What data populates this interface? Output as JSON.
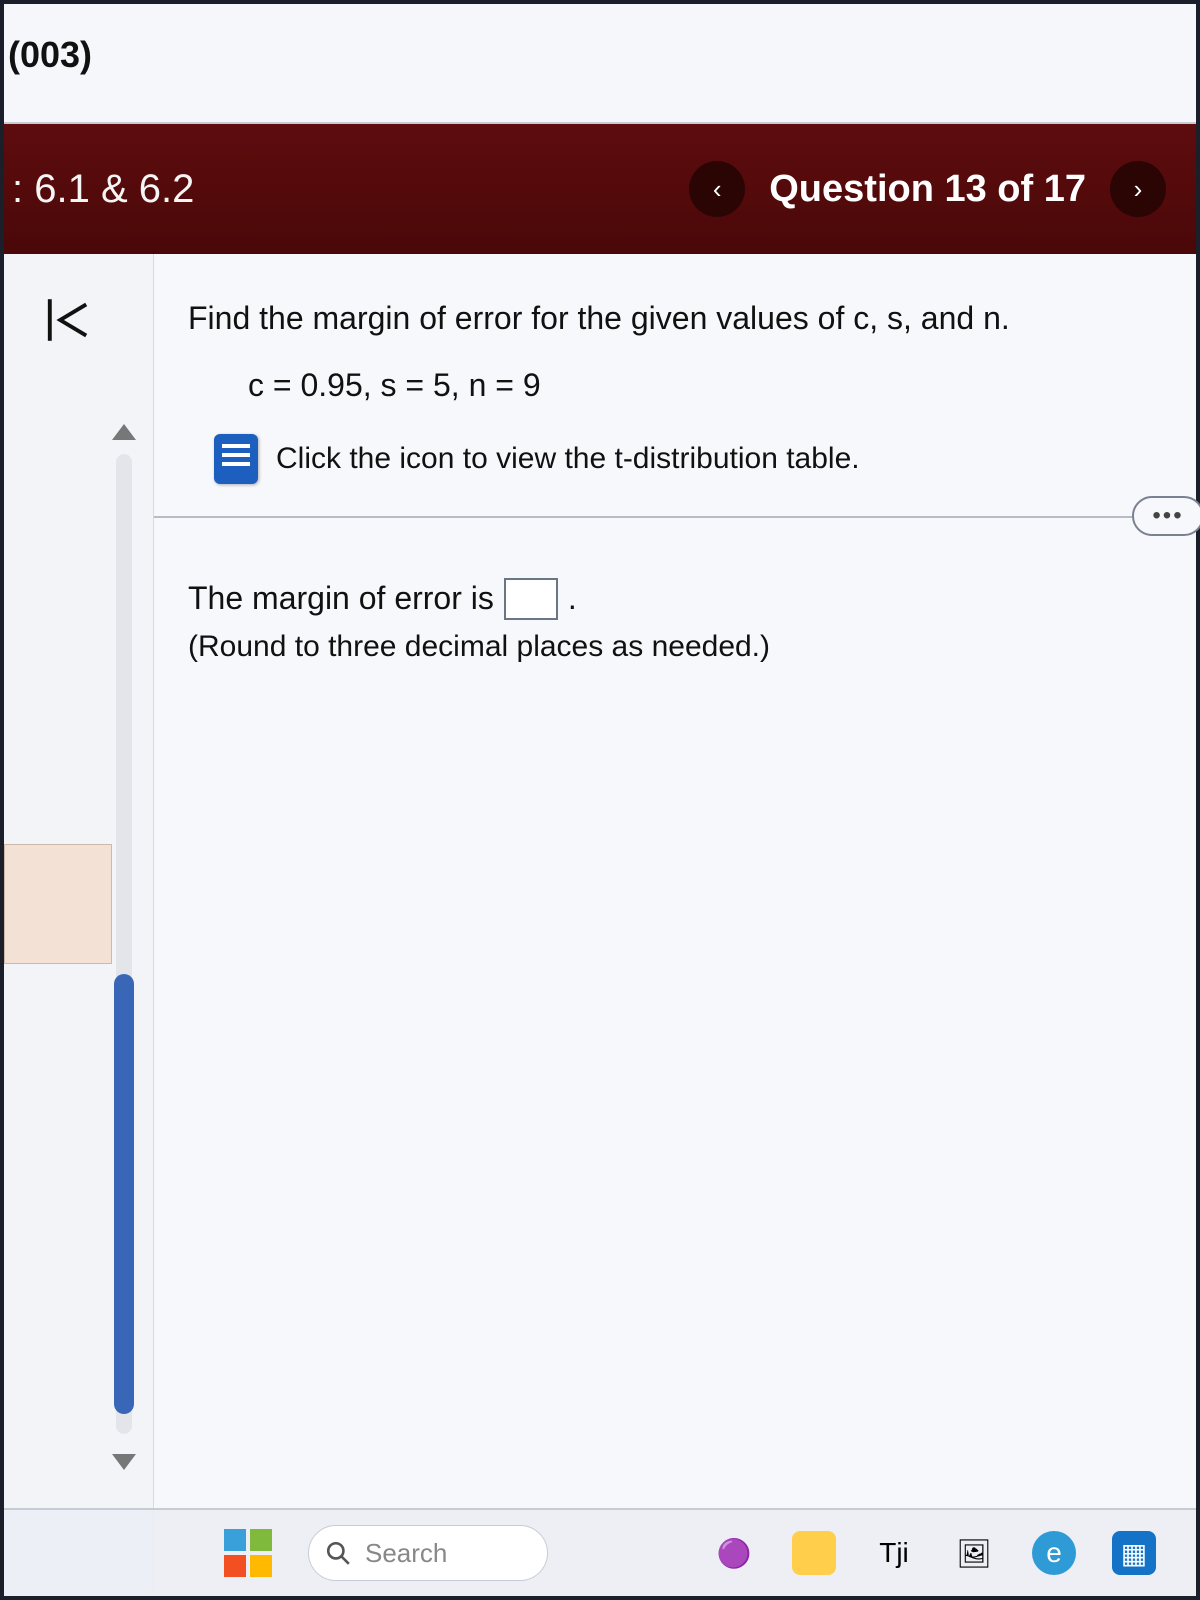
{
  "browser": {
    "tab_code": "(003)"
  },
  "header": {
    "section": ": 6.1 & 6.2",
    "question_counter": "Question 13 of 17",
    "prev_glyph": "‹",
    "next_glyph": "›"
  },
  "question": {
    "prompt": "Find the margin of error for the given values of c, s, and n.",
    "params": "c = 0.95, s = 5, n = 9",
    "icon_text": "Click the icon to view the t-distribution table.",
    "more_glyph": "•••",
    "answer_lead": "The margin of error is",
    "answer_value": "",
    "answer_trail_period": ".",
    "hint": "(Round to three decimal places as needed.)"
  },
  "taskbar": {
    "search_placeholder": "Search"
  }
}
